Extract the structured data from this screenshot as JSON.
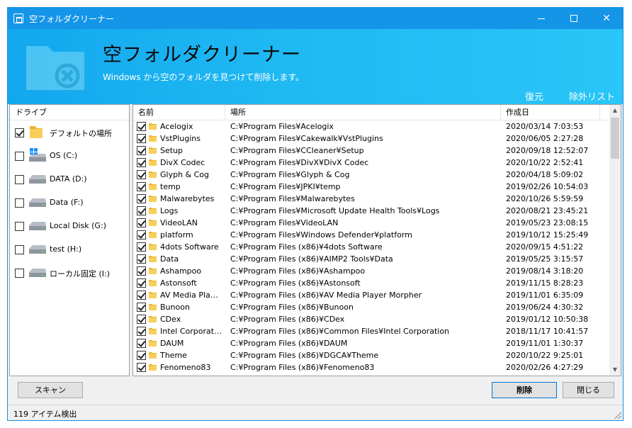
{
  "window": {
    "title": "空フォルダクリーナー"
  },
  "banner": {
    "title": "空フォルダクリーナー",
    "subtitle": "Windows から空のフォルダを見つけて削除します。",
    "restore": "復元",
    "exclude_list": "除外リスト"
  },
  "drive_panel": {
    "header": "ドライブ",
    "items": [
      {
        "label": "デフォルトの場所",
        "icon": "folder-icon",
        "checked": true
      },
      {
        "label": "OS (C:)",
        "icon": "windows-drive-icon",
        "checked": false
      },
      {
        "label": "DATA (D:)",
        "icon": "drive-icon",
        "checked": false
      },
      {
        "label": "Data (F:)",
        "icon": "drive-icon",
        "checked": false
      },
      {
        "label": "Local Disk (G:)",
        "icon": "drive-icon",
        "checked": false
      },
      {
        "label": "test (H:)",
        "icon": "drive-icon",
        "checked": false
      },
      {
        "label": "ローカル固定 (I:)",
        "icon": "drive-icon",
        "checked": false
      }
    ]
  },
  "file_list": {
    "columns": {
      "name": "名前",
      "path": "場所",
      "date": "作成日"
    },
    "rows": [
      {
        "name": "Acelogix",
        "path": "C:¥Program Files¥Acelogix",
        "date": "2020/03/14 7:03:53",
        "checked": true
      },
      {
        "name": "VstPlugins",
        "path": "C:¥Program Files¥Cakewalk¥VstPlugins",
        "date": "2020/06/05 2:27:28",
        "checked": true
      },
      {
        "name": "Setup",
        "path": "C:¥Program Files¥CCleaner¥Setup",
        "date": "2020/09/18 12:52:07",
        "checked": true
      },
      {
        "name": "DivX Codec",
        "path": "C:¥Program Files¥DivX¥DivX Codec",
        "date": "2020/10/22 2:52:41",
        "checked": true
      },
      {
        "name": "Glyph & Cog",
        "path": "C:¥Program Files¥Glyph & Cog",
        "date": "2020/04/18 5:09:02",
        "checked": true
      },
      {
        "name": "temp",
        "path": "C:¥Program Files¥JPKI¥temp",
        "date": "2019/02/26 10:54:03",
        "checked": true
      },
      {
        "name": "Malwarebytes",
        "path": "C:¥Program Files¥Malwarebytes",
        "date": "2020/10/26 5:59:59",
        "checked": true
      },
      {
        "name": "Logs",
        "path": "C:¥Program Files¥Microsoft Update Health Tools¥Logs",
        "date": "2020/08/21 23:45:21",
        "checked": true
      },
      {
        "name": "VideoLAN",
        "path": "C:¥Program Files¥VideoLAN",
        "date": "2019/05/23 23:08:15",
        "checked": true
      },
      {
        "name": "platform",
        "path": "C:¥Program Files¥Windows Defender¥platform",
        "date": "2019/10/12 15:25:49",
        "checked": true
      },
      {
        "name": "4dots Software",
        "path": "C:¥Program Files (x86)¥4dots Software",
        "date": "2020/09/15 4:51:22",
        "checked": true
      },
      {
        "name": "Data",
        "path": "C:¥Program Files (x86)¥AIMP2 Tools¥Data",
        "date": "2019/05/25 3:15:57",
        "checked": true
      },
      {
        "name": "Ashampoo",
        "path": "C:¥Program Files (x86)¥Ashampoo",
        "date": "2019/08/14 3:18:20",
        "checked": true
      },
      {
        "name": "Astonsoft",
        "path": "C:¥Program Files (x86)¥Astonsoft",
        "date": "2019/11/15 8:28:23",
        "checked": true
      },
      {
        "name": "AV Media Playe...",
        "path": "C:¥Program Files (x86)¥AV Media Player Morpher",
        "date": "2019/11/01 6:35:09",
        "checked": true
      },
      {
        "name": "Bunoon",
        "path": "C:¥Program Files (x86)¥Bunoon",
        "date": "2019/06/24 4:30:32",
        "checked": true
      },
      {
        "name": "CDex",
        "path": "C:¥Program Files (x86)¥CDex",
        "date": "2019/01/12 10:50:38",
        "checked": true
      },
      {
        "name": "Intel Corporation",
        "path": "C:¥Program Files (x86)¥Common Files¥Intel Corporation",
        "date": "2018/11/17 10:41:57",
        "checked": true
      },
      {
        "name": "DAUM",
        "path": "C:¥Program Files (x86)¥DAUM",
        "date": "2019/11/01 1:30:37",
        "checked": true
      },
      {
        "name": "Theme",
        "path": "C:¥Program Files (x86)¥DGCA¥Theme",
        "date": "2020/10/22 9:25:01",
        "checked": true
      },
      {
        "name": "Fenomeno83",
        "path": "C:¥Program Files (x86)¥Fenomeno83",
        "date": "2020/02/26 4:27:29",
        "checked": true
      }
    ]
  },
  "buttons": {
    "scan": "スキャン",
    "delete": "削除",
    "close": "閉じる"
  },
  "status": {
    "text": "119 アイテム検出"
  },
  "colors": {
    "titlebar": "#1595e8",
    "banner_start": "#13a7ee",
    "banner_end": "#29c6f7",
    "folder": "#f5c342"
  }
}
